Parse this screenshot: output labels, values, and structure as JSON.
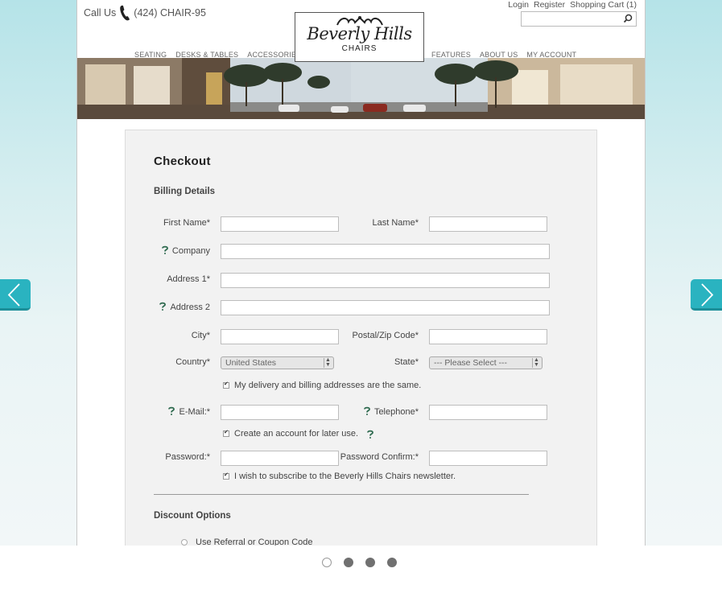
{
  "header": {
    "call_us_label": "Call Us",
    "phone": "(424) CHAIR-95",
    "links": [
      "Login",
      "Register",
      "Shopping Cart (1)"
    ],
    "logo_title": "Beverly Hills",
    "logo_subtitle": "CHAIRS",
    "nav_left": [
      "SEATING",
      "DESKS & TABLES",
      "ACCESSORIES"
    ],
    "nav_right": [
      "FEATURES",
      "ABOUT US",
      "MY ACCOUNT"
    ]
  },
  "checkout": {
    "title": "Checkout",
    "billing_heading": "Billing Details",
    "fields": {
      "first_name": "First Name*",
      "last_name": "Last Name*",
      "company": "Company",
      "address1": "Address 1*",
      "address2": "Address 2",
      "city": "City*",
      "postal": "Postal/Zip Code*",
      "country": "Country*",
      "state": "State*",
      "email": "E-Mail:*",
      "telephone": "Telephone*",
      "password": "Password:*",
      "password_confirm": "Password Confirm:*"
    },
    "country_value": "United States",
    "state_value": "--- Please Select ---",
    "same_address": "My delivery and billing addresses are the same.",
    "create_account": "Create an account for later use.",
    "newsletter": "I wish to subscribe to the Beverly Hills Chairs newsletter.",
    "discount_heading": "Discount Options",
    "coupon_option": "Use Referral or Coupon Code"
  },
  "carousel": {
    "slides": 4,
    "active_index": 0
  },
  "colors": {
    "accent": "#2ab3c0",
    "background_top": "#b5e3e8",
    "panel": "#f2f2f2"
  }
}
